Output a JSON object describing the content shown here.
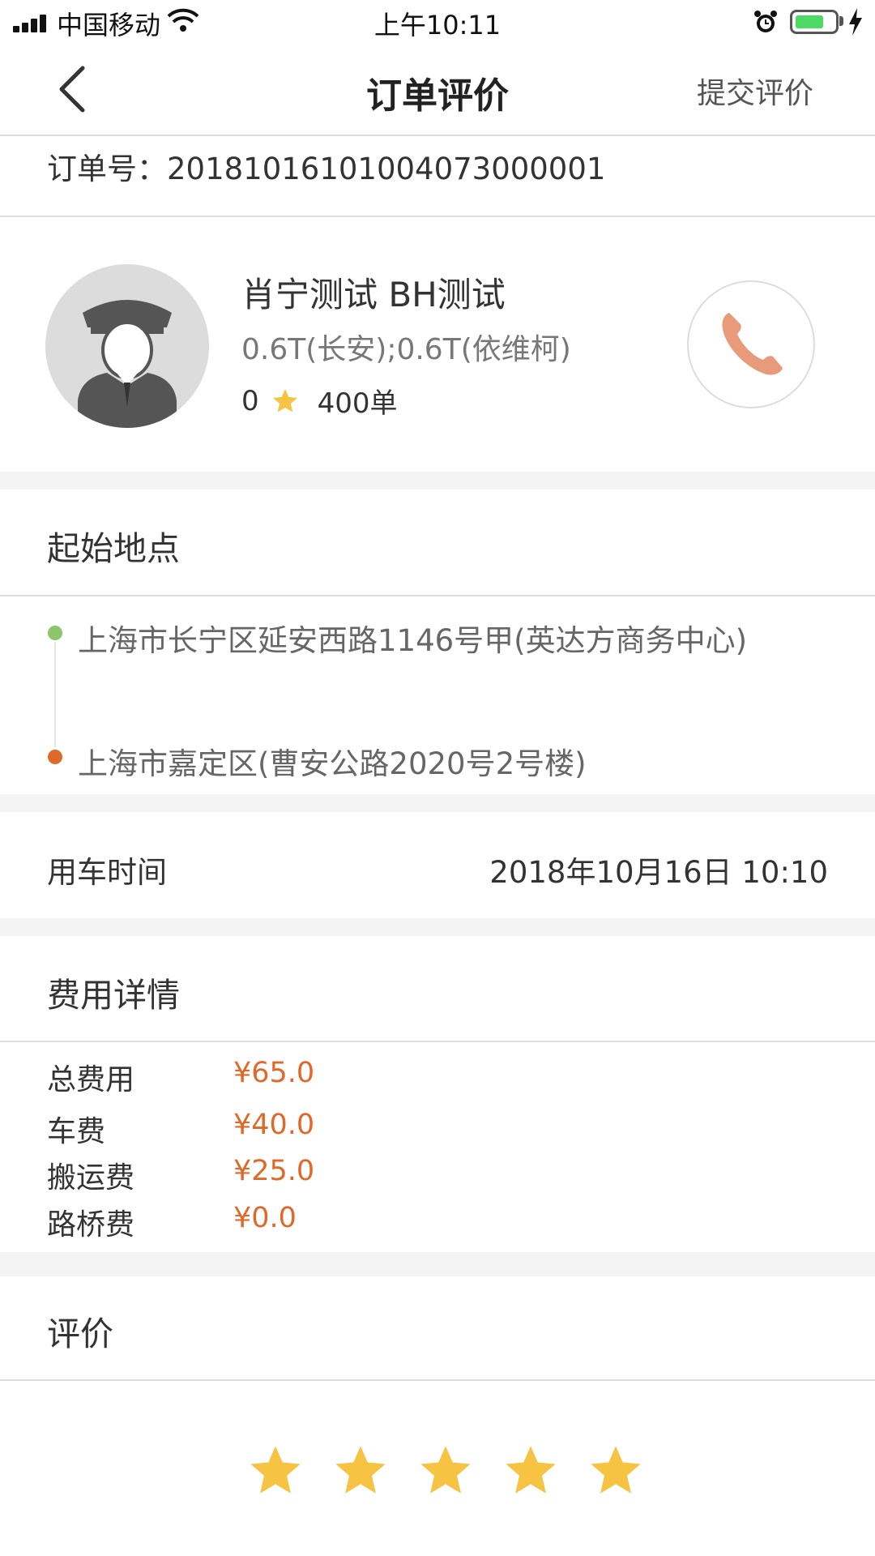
{
  "status_bar": {
    "carrier": "中国移动",
    "time": "上午10:11",
    "battery_level": 0.6
  },
  "nav": {
    "title": "订单评价",
    "submit_label": "提交评价"
  },
  "order": {
    "number_label": "订单号：",
    "number": "20181016101004073000001"
  },
  "driver": {
    "name": "肖宁测试  BH测试",
    "cars": "0.6T(长安);0.6T(依维柯)",
    "rating": "0",
    "orders": "400单"
  },
  "route": {
    "title": "起始地点",
    "start": "上海市长宁区延安西路1146号甲(英达方商务中心)",
    "end": "上海市嘉定区(曹安公路2020号2号楼)",
    "start_color": "#8cc56a",
    "end_color": "#e0692a"
  },
  "use_time": {
    "label": "用车时间",
    "value": "2018年10月16日 10:10"
  },
  "fees": {
    "title": "费用详情",
    "items": [
      {
        "label": "总费用",
        "value": "¥65.0"
      },
      {
        "label": "车费",
        "value": "¥40.0"
      },
      {
        "label": "搬运费",
        "value": "¥25.0"
      },
      {
        "label": "路桥费",
        "value": "¥0.0"
      }
    ]
  },
  "review": {
    "title": "评价",
    "stars_selected": 5,
    "stars_total": 5
  },
  "colors": {
    "accent": "#e0692a",
    "star": "#f7c342",
    "phone_icon": "#e89a7a"
  },
  "icons": [
    "back-chevron-icon",
    "driver-avatar-icon",
    "star-icon",
    "phone-icon",
    "wifi-icon",
    "alarm-icon",
    "battery-icon",
    "charging-bolt-icon"
  ]
}
